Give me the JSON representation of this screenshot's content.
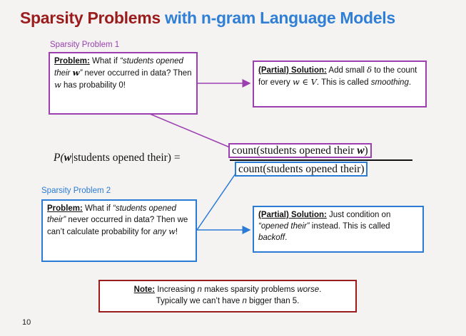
{
  "title": {
    "part1": "Sparsity Problems",
    "part2": "with n-gram Language Models"
  },
  "problem1": {
    "heading": "Sparsity Problem 1",
    "label": "Problem:",
    "text1": " What if ",
    "quote": "“students opened their ",
    "quote_var": "w",
    "quote_end": "”",
    "text2": " never occurred in data? Then ",
    "var": "w",
    "text3": " has probability 0!"
  },
  "solution1": {
    "label": "(Partial) Solution:",
    "text1": " Add small ",
    "delta": "δ",
    "text2": " to the count for every ",
    "math": "w ∈ V",
    "text3": ". This is called ",
    "italic": "smoothing",
    "text4": "."
  },
  "formula": {
    "lhs_p": "P(",
    "lhs_w": "w",
    "lhs_rest": "|students opened their) =",
    "numerator": "count(students opened their ",
    "numerator_w": "w",
    "numerator_end": ")",
    "denominator": "count(students opened their)"
  },
  "problem2": {
    "heading": "Sparsity Problem 2",
    "label": "Problem:",
    "text1": " What if ",
    "quote": "“students opened their”",
    "text2": " never occurred in data? Then we can’t calculate probability for ",
    "italic": "any",
    "var": "w",
    "text3": "!"
  },
  "solution2": {
    "label": "(Partial) Solution:",
    "text1": " Just condition on ",
    "quote": "“opened their”",
    "text2": " instead. This is called ",
    "italic": "backoff",
    "text3": "."
  },
  "note": {
    "label": "Note:",
    "text1": " Increasing ",
    "n1": "n",
    "text2": " makes sparsity problems ",
    "italic": "worse",
    "text3": ".",
    "line2a": "Typically we can’t have ",
    "n2": "n",
    "line2b": " bigger than 5."
  },
  "page_number": "10",
  "colors": {
    "title_red": "#9b1c1c",
    "title_blue": "#2f7fd6",
    "purple": "#9b3fb1",
    "blue": "#2a7bd6"
  }
}
